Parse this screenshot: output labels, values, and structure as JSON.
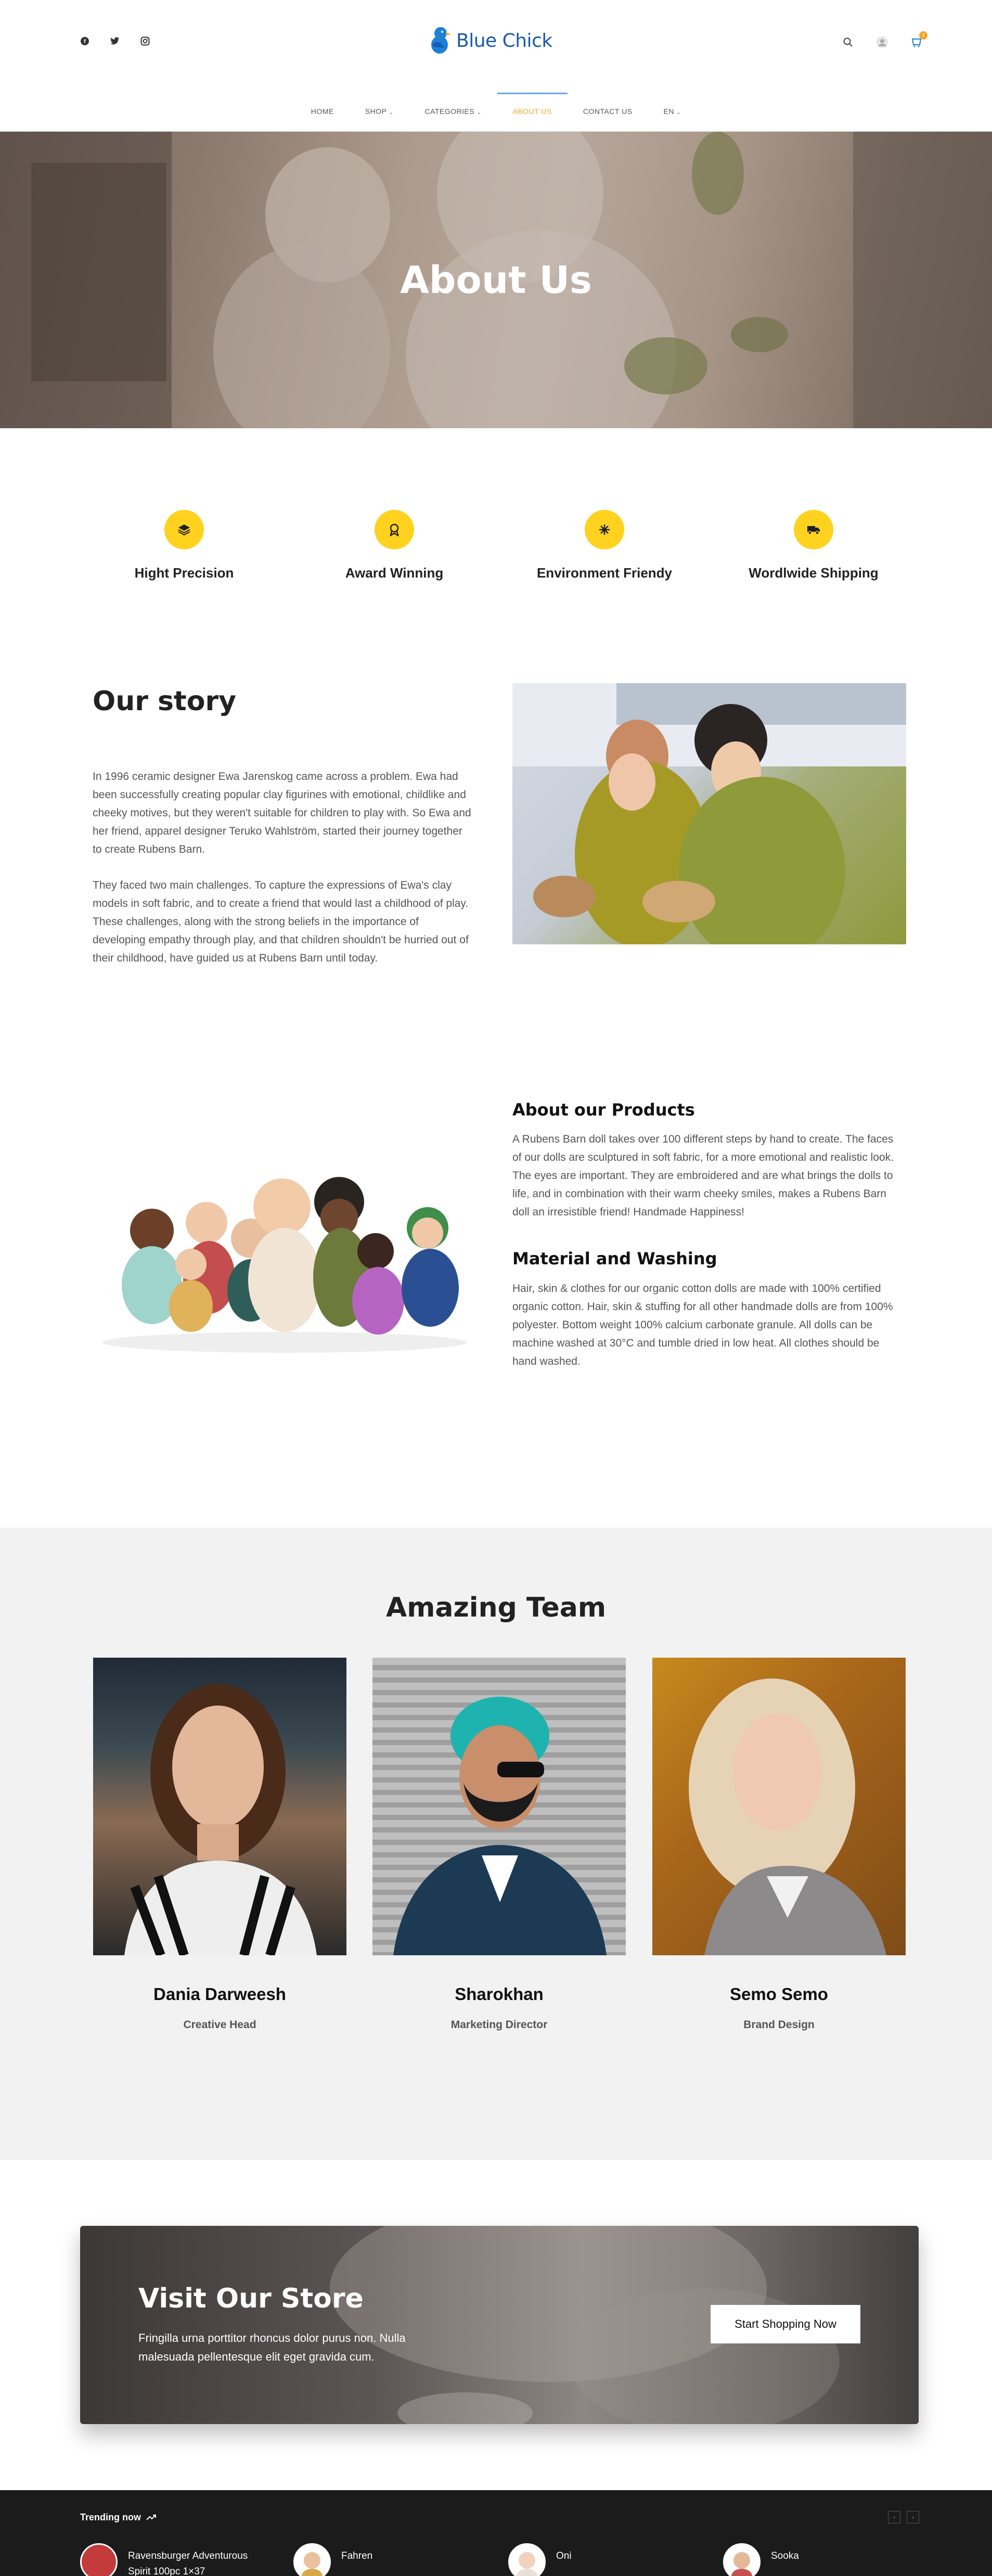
{
  "header": {
    "social": [
      {
        "icon": "facebook-icon",
        "glyph": "f"
      },
      {
        "icon": "twitter-icon",
        "glyph": "t"
      },
      {
        "icon": "instagram-icon",
        "glyph": "◎"
      }
    ],
    "logo_text": "Blue Chick",
    "cart_count": "2"
  },
  "nav": {
    "items": [
      {
        "label": "HOME",
        "chevron": false
      },
      {
        "label": "SHOP",
        "chevron": true
      },
      {
        "label": "CATEGORIES",
        "chevron": true
      },
      {
        "label": "ABOUT US",
        "chevron": false,
        "active": true
      },
      {
        "label": "CONTACT US",
        "chevron": false
      },
      {
        "label": "EN",
        "chevron": true
      }
    ]
  },
  "hero": {
    "title": "About Us"
  },
  "features": [
    {
      "label": "Hight Precision",
      "icon": "layers-icon"
    },
    {
      "label": "Award Winning",
      "icon": "award-icon"
    },
    {
      "label": "Environment Friendy",
      "icon": "snowflake-icon"
    },
    {
      "label": "Wordlwide Shipping",
      "icon": "truck-icon"
    }
  ],
  "story": {
    "title": "Our story",
    "p1": "In 1996 ceramic designer Ewa Jarenskog came across a problem. Ewa had been successfully creating popular clay figurines with emotional, childlike and cheeky motives, but they weren't suitable for children to play with. So Ewa and her friend, apparel designer Teruko Wahlström, started their journey together to create Rubens Barn.",
    "p2": "They faced two main challenges. To capture the expressions of Ewa's clay models in soft fabric, and to create a friend that would last a childhood of play. These challenges, along with the strong beliefs in the importance of developing empathy through play, and that children shouldn't be hurried out of their childhood, have guided us at Rubens Barn until today."
  },
  "products": {
    "title": "About our Products",
    "text": "A Rubens Barn doll takes over 100 different steps by hand to create. The faces of our dolls are sculptured in soft fabric, for a more emotional and realistic look. The eyes are important. They are embroidered and are what brings the dolls to life, and in combination with their warm cheeky smiles, makes a Rubens Barn doll an irresistible friend! Handmade Happiness!",
    "washing_title": "Material and Washing",
    "washing_text": "Hair, skin & clothes for our organic cotton dolls are made with 100% certified organic cotton. Hair, skin & stuffing for all other handmade dolls are from 100% polyester. Bottom weight 100% calcium carbonate granule. All dolls can be machine washed at 30°C and tumble dried in low heat. All clothes should be hand washed."
  },
  "team": {
    "title": "Amazing Team",
    "members": [
      {
        "name": "Dania Darweesh",
        "role": "Creative Head"
      },
      {
        "name": "Sharokhan",
        "role": "Marketing Director"
      },
      {
        "name": "Semo Semo",
        "role": "Brand Design"
      }
    ]
  },
  "store": {
    "title": "Visit Our Store",
    "text": "Fringilla urna porttitor rhoncus dolor purus non. Nulla malesuada pellentesque elit eget gravida cum.",
    "button": "Start Shopping Now"
  },
  "footer": {
    "trending_label": "Trending now",
    "items": [
      {
        "name": "Ravensburger Adventurous Spirit 100pc 1×37"
      },
      {
        "name": "Fahren"
      },
      {
        "name": "Oni"
      },
      {
        "name": "Sooka"
      }
    ]
  },
  "colors": {
    "accent": "#ffd21f",
    "brand": "#1a5aa8",
    "active_nav": "#f5a623"
  }
}
